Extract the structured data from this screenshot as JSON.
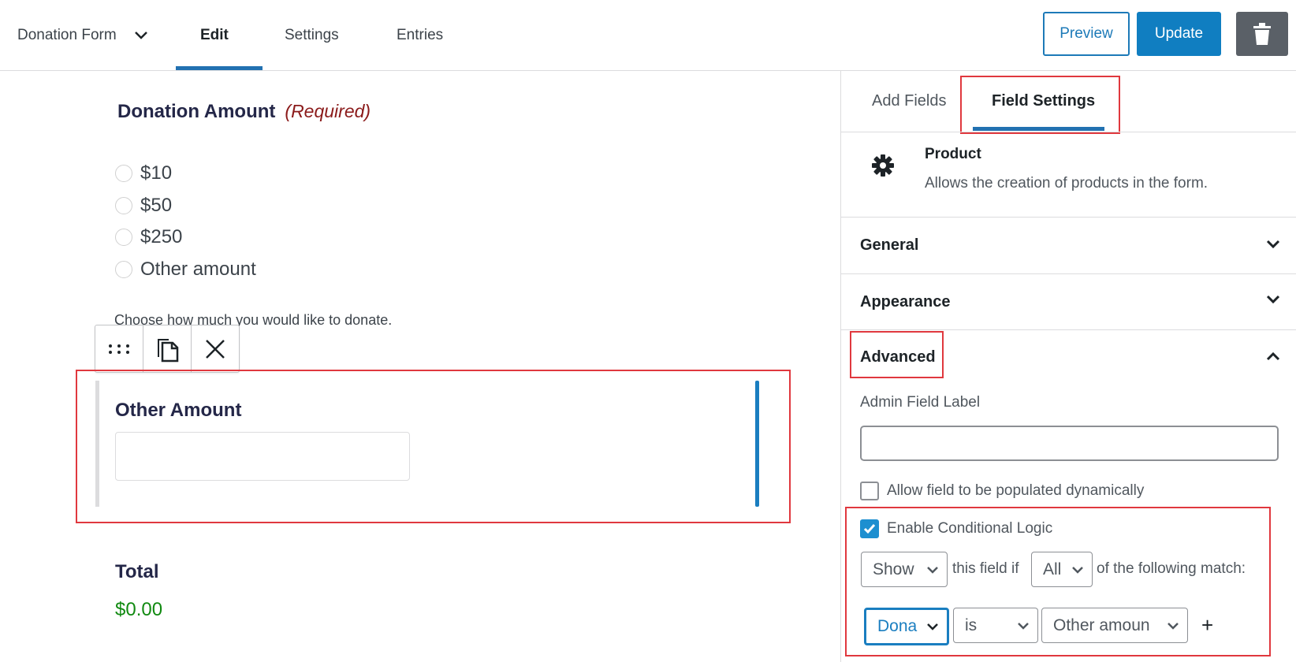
{
  "header": {
    "form_name": "Donation Form",
    "tabs": [
      {
        "label": "Edit",
        "active": true
      },
      {
        "label": "Settings",
        "active": false
      },
      {
        "label": "Entries",
        "active": false
      }
    ],
    "preview_label": "Preview",
    "update_label": "Update",
    "trash_icon": "trash-icon"
  },
  "canvas": {
    "donation_field": {
      "title": "Donation Amount",
      "required_label": "(Required)",
      "options": [
        "$10",
        "$50",
        "$250",
        "Other amount"
      ],
      "description": "Choose how much you would like to donate."
    },
    "field_toolbar": {
      "icons": [
        "drag-handle-icon",
        "duplicate-icon",
        "close-icon"
      ]
    },
    "other_amount_field": {
      "title": "Other Amount",
      "value": ""
    },
    "total_field": {
      "title": "Total",
      "value": "$0.00"
    }
  },
  "sidebar": {
    "tabs": [
      {
        "label": "Add Fields",
        "active": false
      },
      {
        "label": "Field Settings",
        "active": true
      }
    ],
    "field_type": {
      "icon": "gear-icon",
      "title": "Product",
      "description": "Allows the creation of products in the form."
    },
    "sections": [
      {
        "label": "General",
        "expanded": false
      },
      {
        "label": "Appearance",
        "expanded": false
      },
      {
        "label": "Advanced",
        "expanded": true
      }
    ],
    "advanced": {
      "admin_label": "Admin Field Label",
      "admin_value": "",
      "populate_label": "Allow field to be populated dynamically",
      "populate_checked": false,
      "conditional_label": "Enable Conditional Logic",
      "conditional_checked": true,
      "action_value": "Show",
      "text_this_field_if": "this field if",
      "logic_type_value": "All",
      "text_of_following": "of the following match:",
      "rule_field_value": "Dona",
      "rule_operator_value": "is",
      "rule_value": "Other amoun",
      "add_rule_label": "+"
    }
  },
  "colors": {
    "accent": "#2271b1",
    "button_primary": "#107ec1",
    "highlight_red": "#e0383e",
    "required": "#8b1a1a",
    "total_green": "#118a11"
  }
}
